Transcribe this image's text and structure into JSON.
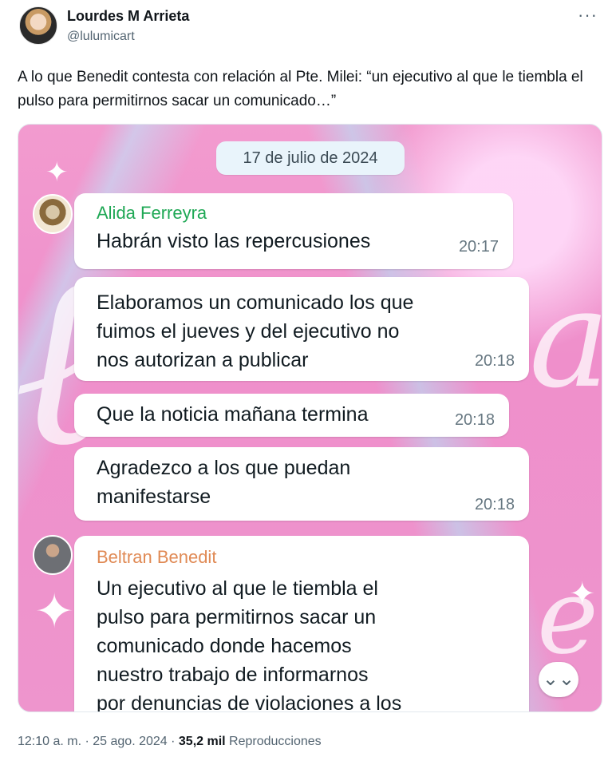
{
  "author": {
    "name": "Lourdes M Arrieta",
    "handle": "@lulumicart"
  },
  "more_label": "···",
  "tweet_text": "A lo que Benedit contesta con relación al Pte. Milei: “un ejecutivo al que le tiembla el pulso para permitirnos sacar un comunicado…”",
  "chat": {
    "date": "17 de julio de 2024",
    "messages": [
      {
        "sender": "Alida Ferreyra",
        "sender_color": "#1fa855",
        "text": "Habrán visto las repercusiones",
        "time": "20:17"
      },
      {
        "text": "Elaboramos un comunicado los que\nfuimos el jueves y del ejecutivo no\nnos autorizan a publicar",
        "time": "20:18"
      },
      {
        "text": "Que la noticia mañana termina",
        "time": "20:18"
      },
      {
        "text": "Agradezco a los que puedan\nmanifestarse",
        "time": "20:18"
      },
      {
        "sender": "Beltran Benedit",
        "sender_color": "#e08a55",
        "text": "Un ejecutivo al que le tiembla el\npulso para permitirnos sacar un\ncomunicado donde hacemos\nnuestro trabajo de informarnos\npor denuncias de violaciones a los"
      }
    ],
    "scroll_icon": "double-chevron-down-icon"
  },
  "meta": {
    "time": "12:10 a. m.",
    "sep1": " · ",
    "date": "25 ago. 2024",
    "sep2": " · ",
    "views": "35,2 mil",
    "views_label": " Reproducciones"
  }
}
